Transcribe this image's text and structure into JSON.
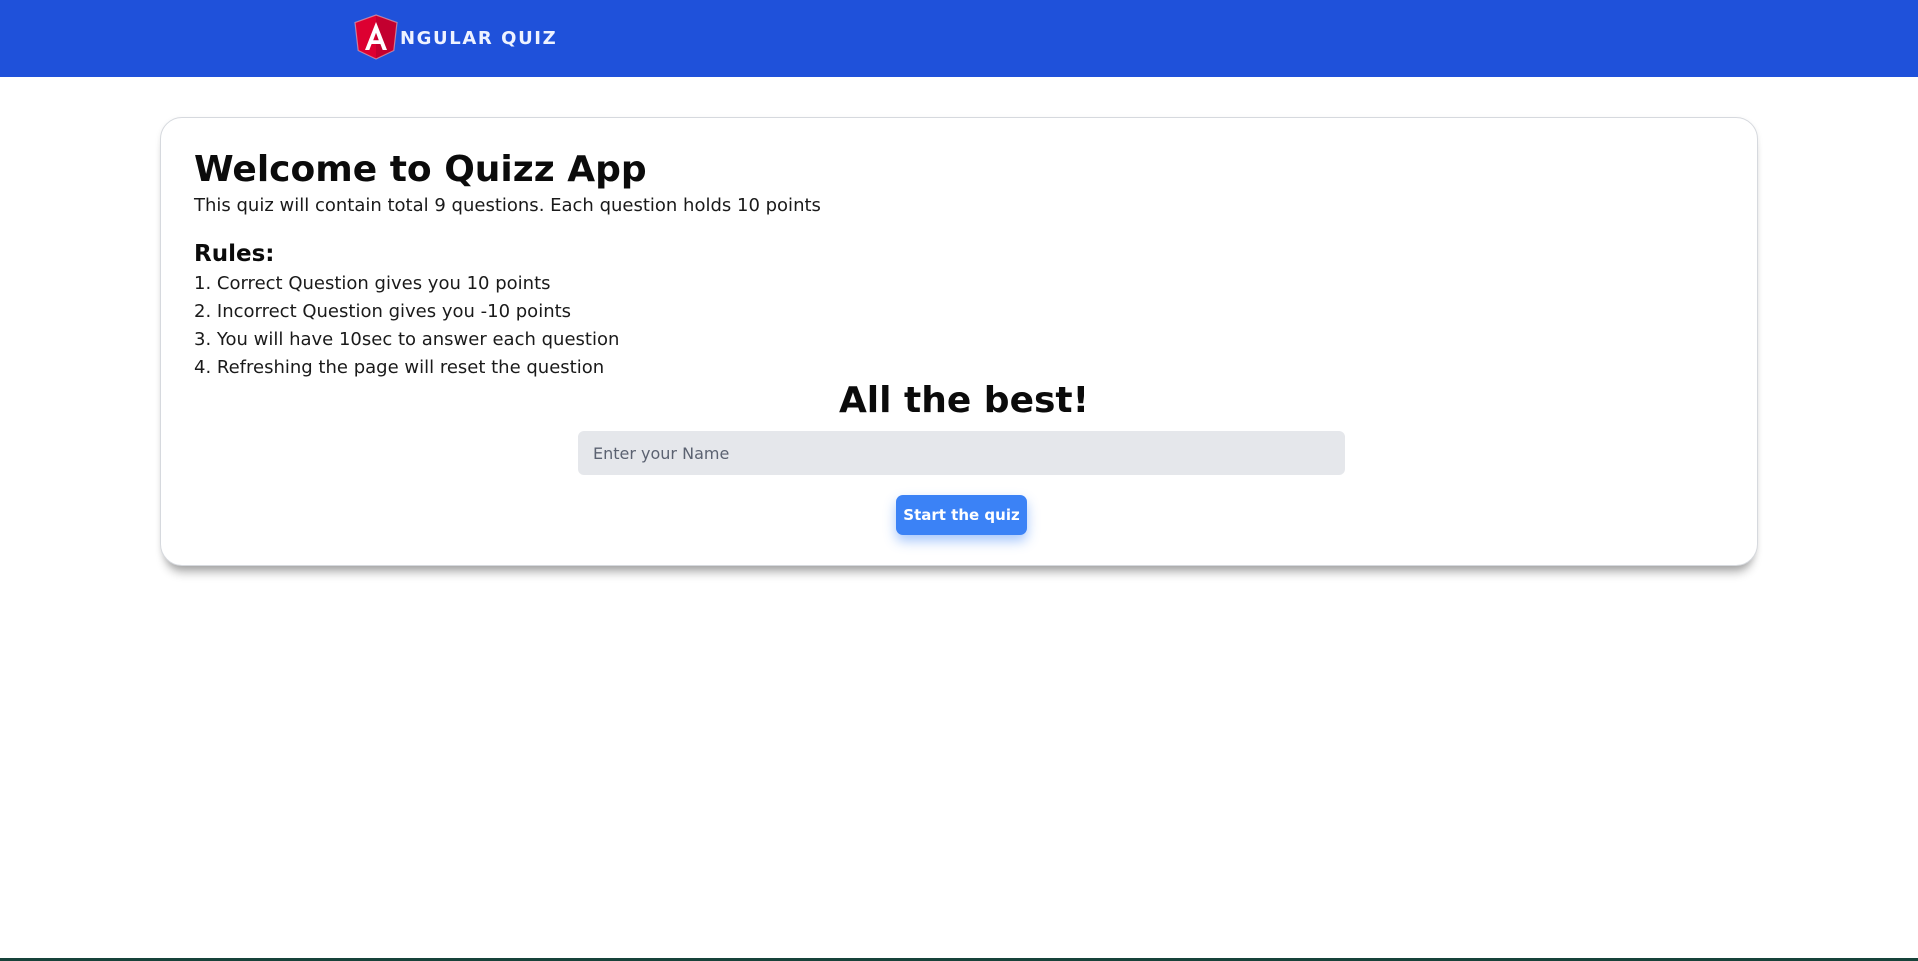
{
  "navbar": {
    "logo_icon": "angular-shield-icon",
    "logo_letter": "A",
    "brand_text": "NGULAR QUIZ",
    "background_color": "#1f51da"
  },
  "intro": {
    "title": "Welcome to Quizz App",
    "subtitle": "This quiz will contain total 9 questions. Each question holds 10 points"
  },
  "rules": {
    "heading": "Rules:",
    "items": [
      "1. Correct Question gives you 10 points",
      "2. Incorrect Question gives you -10 points",
      "3. You will have 10sec to answer each question",
      "4. Refreshing the page will reset the question"
    ]
  },
  "closing": {
    "message": "All the best!"
  },
  "form": {
    "name_value": "",
    "name_placeholder": "Enter your Name",
    "start_label": "Start the quiz",
    "button_color": "#3b82f6"
  }
}
